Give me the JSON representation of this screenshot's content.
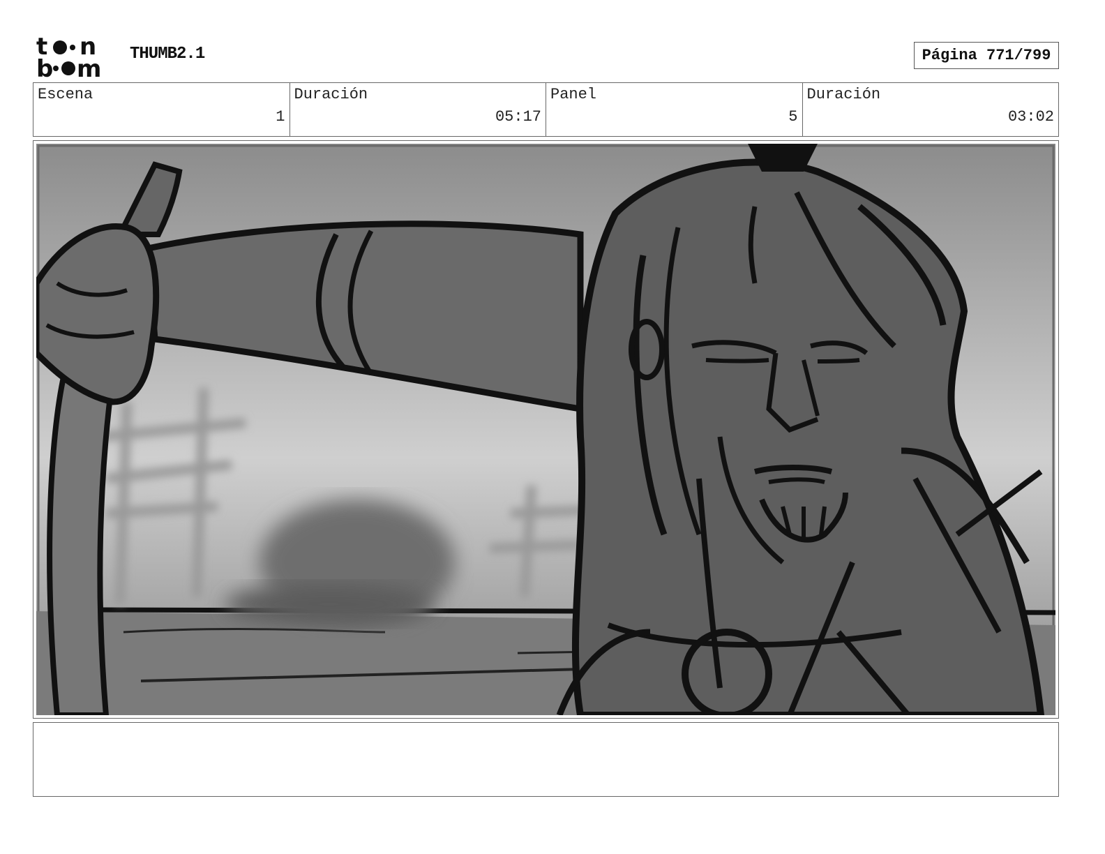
{
  "header": {
    "logo_text_top": "toon",
    "logo_text_bottom": "boom",
    "project_title": "THUMB2.1",
    "page_label": "Página 771/799"
  },
  "info": {
    "scene_label": "Escena",
    "scene_value": "1",
    "scene_duration_label": "Duración",
    "scene_duration_value": "05:17",
    "panel_label": "Panel",
    "panel_value": "5",
    "panel_duration_label": "Duración",
    "panel_duration_value": "03:02"
  },
  "panel": {
    "image_desc": "storyboard-sketch-samurai-drawing-sword"
  },
  "caption": {
    "text": ""
  }
}
